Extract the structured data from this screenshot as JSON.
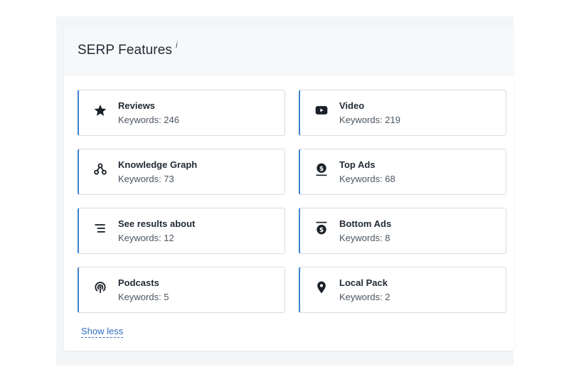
{
  "header": {
    "title": "SERP Features",
    "info_label": "i"
  },
  "features": [
    {
      "title": "Reviews",
      "count": "Keywords: 246",
      "icon": "star-icon"
    },
    {
      "title": "Video",
      "count": "Keywords: 219",
      "icon": "video-icon"
    },
    {
      "title": "Knowledge Graph",
      "count": "Keywords: 73",
      "icon": "knowledge-graph-icon"
    },
    {
      "title": "Top Ads",
      "count": "Keywords: 68",
      "icon": "top-ads-icon"
    },
    {
      "title": "See results about",
      "count": "Keywords: 12",
      "icon": "list-icon"
    },
    {
      "title": "Bottom Ads",
      "count": "Keywords: 8",
      "icon": "bottom-ads-icon"
    },
    {
      "title": "Podcasts",
      "count": "Keywords: 5",
      "icon": "podcast-icon"
    },
    {
      "title": "Local Pack",
      "count": "Keywords: 2",
      "icon": "map-pin-icon"
    }
  ],
  "footer": {
    "show_less_label": "Show less"
  },
  "colors": {
    "accent": "#3d82d0",
    "link": "#2f6fbf",
    "icon": "#1b2128"
  }
}
